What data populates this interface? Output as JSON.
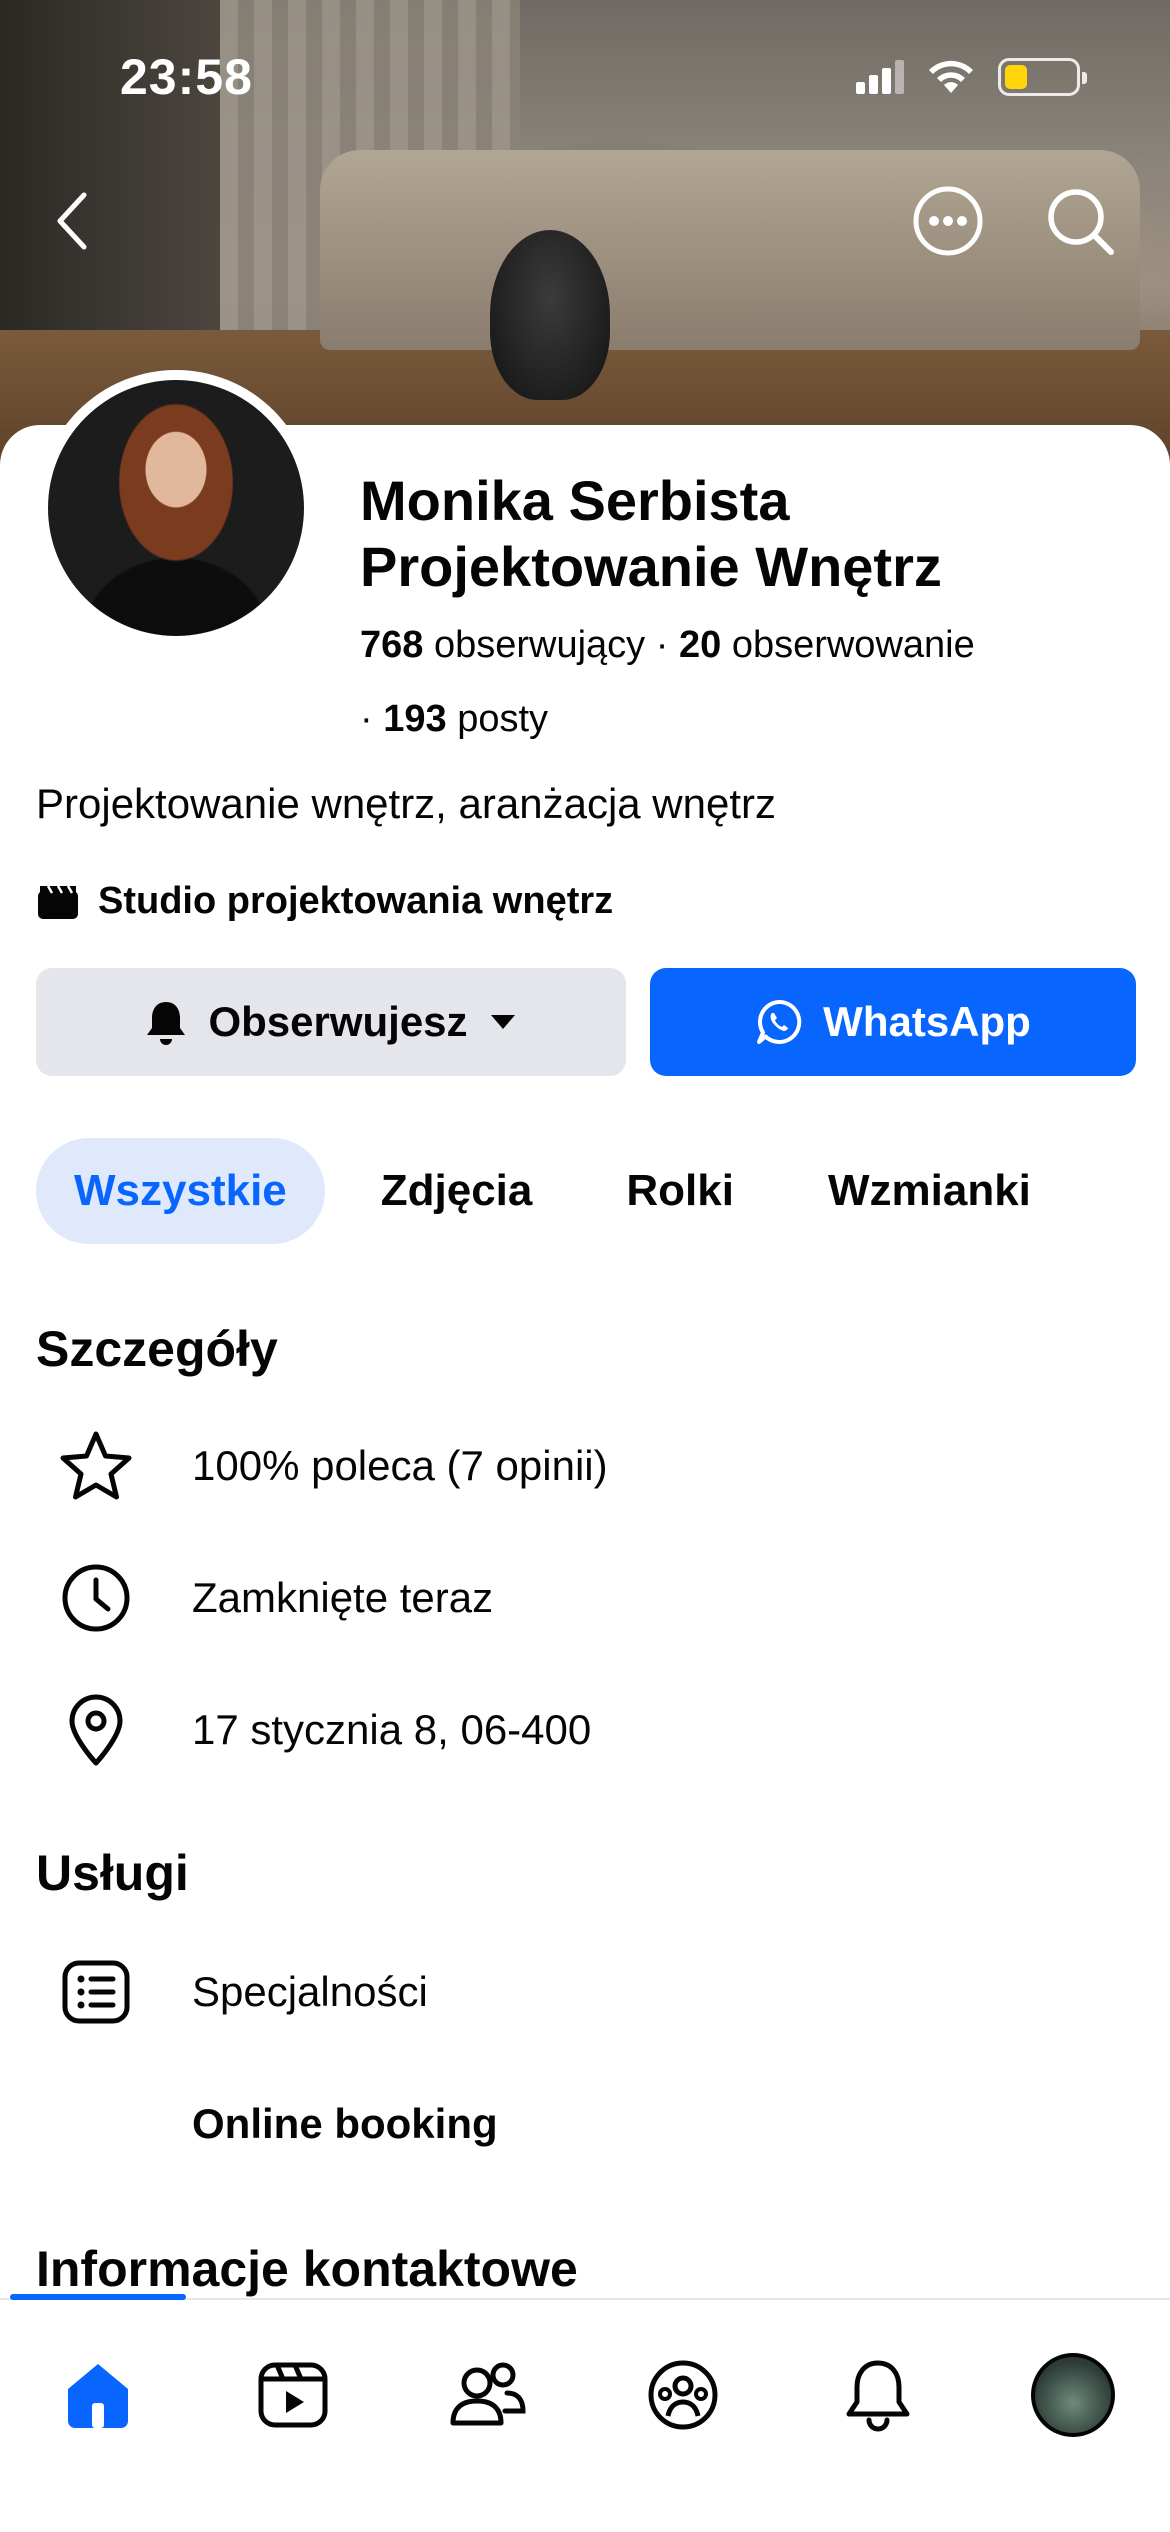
{
  "status_bar": {
    "time": "23:58"
  },
  "page": {
    "name_line1": "Monika Serbista",
    "name_line2": "Projektowanie Wnętrz",
    "followers_count": "768",
    "followers_label": "obserwujący",
    "following_count": "20",
    "following_label": "obserwowanie",
    "posts_count": "193",
    "posts_label": "posty",
    "bio": "Projektowanie wnętrz, aranżacja wnętrz",
    "category": "Studio projektowania wnętrz"
  },
  "actions": {
    "follow_label": "Obserwujesz",
    "whatsapp_label": "WhatsApp"
  },
  "tabs": [
    {
      "label": "Wszystkie",
      "active": true
    },
    {
      "label": "Zdjęcia",
      "active": false
    },
    {
      "label": "Rolki",
      "active": false
    },
    {
      "label": "Wzmianki",
      "active": false
    }
  ],
  "details": {
    "title": "Szczegóły",
    "items": [
      {
        "icon": "star-icon",
        "text": "100% poleca (7 opinii)"
      },
      {
        "icon": "clock-icon",
        "text": "Zamknięte teraz"
      },
      {
        "icon": "location-pin-icon",
        "text": "17 stycznia 8, 06-400"
      }
    ]
  },
  "services": {
    "title": "Usługi",
    "items": [
      {
        "icon": "list-icon",
        "text": "Specjalności"
      },
      {
        "icon": "",
        "text": "Online booking"
      }
    ]
  },
  "contact": {
    "title": "Informacje kontaktowe"
  },
  "bottom_nav": [
    {
      "icon": "home-icon",
      "active": true
    },
    {
      "icon": "video-icon",
      "active": false
    },
    {
      "icon": "friends-icon",
      "active": false
    },
    {
      "icon": "groups-icon",
      "active": false
    },
    {
      "icon": "bell-icon",
      "active": false
    },
    {
      "icon": "profile-avatar",
      "active": false
    }
  ],
  "colors": {
    "accent": "#0866ff",
    "tab_active_bg": "#dfe9fb",
    "button_gray": "#e4e6eb",
    "battery": "#ffd60a"
  }
}
